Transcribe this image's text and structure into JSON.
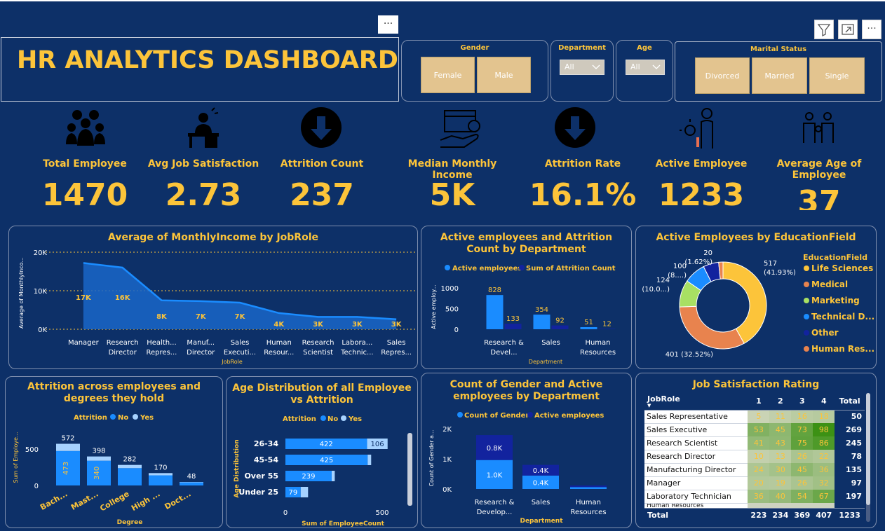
{
  "menu": {
    "ellipsis": "···"
  },
  "title": "HR ANALYTICS DASHBOARD",
  "slicers": {
    "gender": {
      "label": "Gender",
      "options": [
        "Female",
        "Male"
      ]
    },
    "department": {
      "label": "Department",
      "value": "All"
    },
    "age": {
      "label": "Age",
      "value": "All"
    },
    "marital": {
      "label": "Marital Status",
      "options": [
        "Divorced",
        "Married",
        "Single"
      ]
    }
  },
  "kpis": [
    {
      "label": "Total Employee",
      "value": "1470",
      "icon": "people-group-icon"
    },
    {
      "label": "Avg Job Satisfaction",
      "value": "2.73",
      "icon": "worker-desk-icon"
    },
    {
      "label": "Attrition Count",
      "value": "237",
      "icon": "down-arrow-circle-icon"
    },
    {
      "label": "Median Monthly Income",
      "value": "5K",
      "icon": "salary-hand-icon"
    },
    {
      "label": "Attrition Rate",
      "value": "16.1%",
      "icon": "down-arrow-circle-icon"
    },
    {
      "label": "Active Employee",
      "value": "1233",
      "icon": "active-person-icon"
    },
    {
      "label": "Average Age of Employee",
      "value": "37",
      "icon": "family-icon"
    }
  ],
  "colors": {
    "background": "#0d3068",
    "accent": "#fcc43a",
    "bar_light": "#1a8cff",
    "bar_dark": "#12239e",
    "chip": "#e3c48f"
  },
  "chart_data": [
    {
      "id": "income",
      "type": "area",
      "title": "Average of MonthlyIncome by JobRole",
      "xlabel": "JobRole",
      "ylabel": "Average of MonthlyInco...",
      "categories": [
        "Manager",
        "Research Director",
        "Health... Repres...",
        "Manuf... Director",
        "Sales Executi...",
        "Human Resour...",
        "Research Scientist",
        "Labora... Technic...",
        "Sales Repres..."
      ],
      "values": [
        17.2,
        16.0,
        7.5,
        7.3,
        6.9,
        4.2,
        3.2,
        3.2,
        2.6
      ],
      "data_labels": [
        "17K",
        "16K",
        "8K",
        "7K",
        "7K",
        "4K",
        "3K",
        "3K",
        "3K"
      ],
      "yticks": [
        "0K",
        "10K",
        "20K"
      ],
      "ylim": [
        0,
        20
      ]
    },
    {
      "id": "dept",
      "type": "bar",
      "title": "Active employees and Attrition Count by Department",
      "xlabel": "Department",
      "ylabel": "Active employ...",
      "categories": [
        "Research & Devel...",
        "Sales",
        "Human Resources"
      ],
      "series": [
        {
          "name": "Active employees",
          "values": [
            828,
            354,
            51
          ]
        },
        {
          "name": "Sum of Attrition Count",
          "values": [
            133,
            92,
            12
          ]
        }
      ],
      "yticks": [
        "0",
        "500",
        "1000"
      ],
      "ylim": [
        0,
        1100
      ]
    },
    {
      "id": "edu",
      "type": "pie",
      "title": "Active Employees by EducationField",
      "legend_title": "EducationField",
      "slices": [
        {
          "name": "Life Sciences",
          "value": 517,
          "label": "517 (41.93%)"
        },
        {
          "name": "Medical",
          "value": 401,
          "label": "401 (32.52%)"
        },
        {
          "name": "Marketing",
          "value": 124,
          "label": "124 (10.0...)"
        },
        {
          "name": "Technical D...",
          "value": 100,
          "label": "100 (8....)"
        },
        {
          "name": "Other",
          "value": 20,
          "label": "20 (1.62%)"
        },
        {
          "name": "Human Res...",
          "value": 71,
          "label": ""
        }
      ]
    },
    {
      "id": "degree",
      "type": "bar",
      "title": "Attrition across employees and degrees they hold",
      "legend_title": "Attrition",
      "xlabel": "Degree",
      "ylabel": "Sum of Employe...",
      "categories": [
        "Bach...",
        "Mast...",
        "College",
        "High ...",
        "Doct..."
      ],
      "series": [
        {
          "name": "No",
          "values": [
            473,
            340,
            238,
            139,
            43
          ]
        },
        {
          "name": "Yes",
          "values": [
            99,
            58,
            44,
            31,
            5
          ]
        }
      ],
      "totals": [
        "572",
        "398",
        "282",
        "170",
        "48"
      ],
      "inner_labels": [
        "473",
        "340",
        "",
        "",
        ""
      ],
      "yticks": [
        "0",
        "500"
      ],
      "ylim": [
        0,
        600
      ]
    },
    {
      "id": "age",
      "type": "bar",
      "title": "Age Distribution of all Employee vs Attrition",
      "legend_title": "Attrition",
      "xlabel": "Sum of EmployeeCount",
      "ylabel": "Age Distribution",
      "categories": [
        "26-34",
        "45-54",
        "Over 55",
        "Under 25"
      ],
      "series": [
        {
          "name": "No",
          "values": [
            422,
            425,
            239,
            79
          ]
        },
        {
          "name": "Yes",
          "values": [
            106,
            18,
            16,
            38
          ]
        }
      ],
      "data_labels": [
        [
          "422",
          "106"
        ],
        [
          "425",
          ""
        ],
        [
          "239",
          ""
        ],
        [
          "79",
          ""
        ]
      ],
      "xticks": [
        "0",
        "500"
      ],
      "xlim": [
        0,
        550
      ]
    },
    {
      "id": "gender",
      "type": "bar",
      "title": "Count of Gender and Active employees by Department",
      "xlabel": "Department",
      "ylabel": "Count of Gender a...",
      "categories": [
        "Research & Develop...",
        "Sales",
        "Human Resources"
      ],
      "series": [
        {
          "name": "Count of Gender",
          "values": [
            961,
            446,
            63
          ]
        },
        {
          "name": "Active employees",
          "values": [
            828,
            354,
            51
          ]
        }
      ],
      "data_labels": [
        [
          "1.0K",
          "0.8K"
        ],
        [
          "0.4K",
          "0.4K"
        ],
        [
          "",
          ""
        ]
      ],
      "yticks": [
        "0K",
        "1K",
        "2K"
      ],
      "ylim": [
        0,
        2200
      ]
    },
    {
      "id": "jobsat",
      "type": "table",
      "title": "Job Satisfaction Rating",
      "columns": [
        "JobRole",
        "1",
        "2",
        "3",
        "4",
        "Total"
      ],
      "rows": [
        [
          "Sales Representative",
          "5",
          "11",
          "16",
          "18",
          "50"
        ],
        [
          "Sales Executive",
          "53",
          "45",
          "73",
          "98",
          "269"
        ],
        [
          "Research Scientist",
          "41",
          "43",
          "75",
          "86",
          "245"
        ],
        [
          "Research Director",
          "10",
          "13",
          "26",
          "22",
          "78"
        ],
        [
          "Manufacturing Director",
          "24",
          "30",
          "45",
          "36",
          "135"
        ],
        [
          "Manager",
          "20",
          "19",
          "26",
          "32",
          "97"
        ],
        [
          "Laboratory Technician",
          "36",
          "40",
          "54",
          "67",
          "197"
        ]
      ],
      "clipped_row": "Human Resources",
      "total_row": [
        "Total",
        "223",
        "234",
        "369",
        "407",
        "1233"
      ]
    }
  ]
}
